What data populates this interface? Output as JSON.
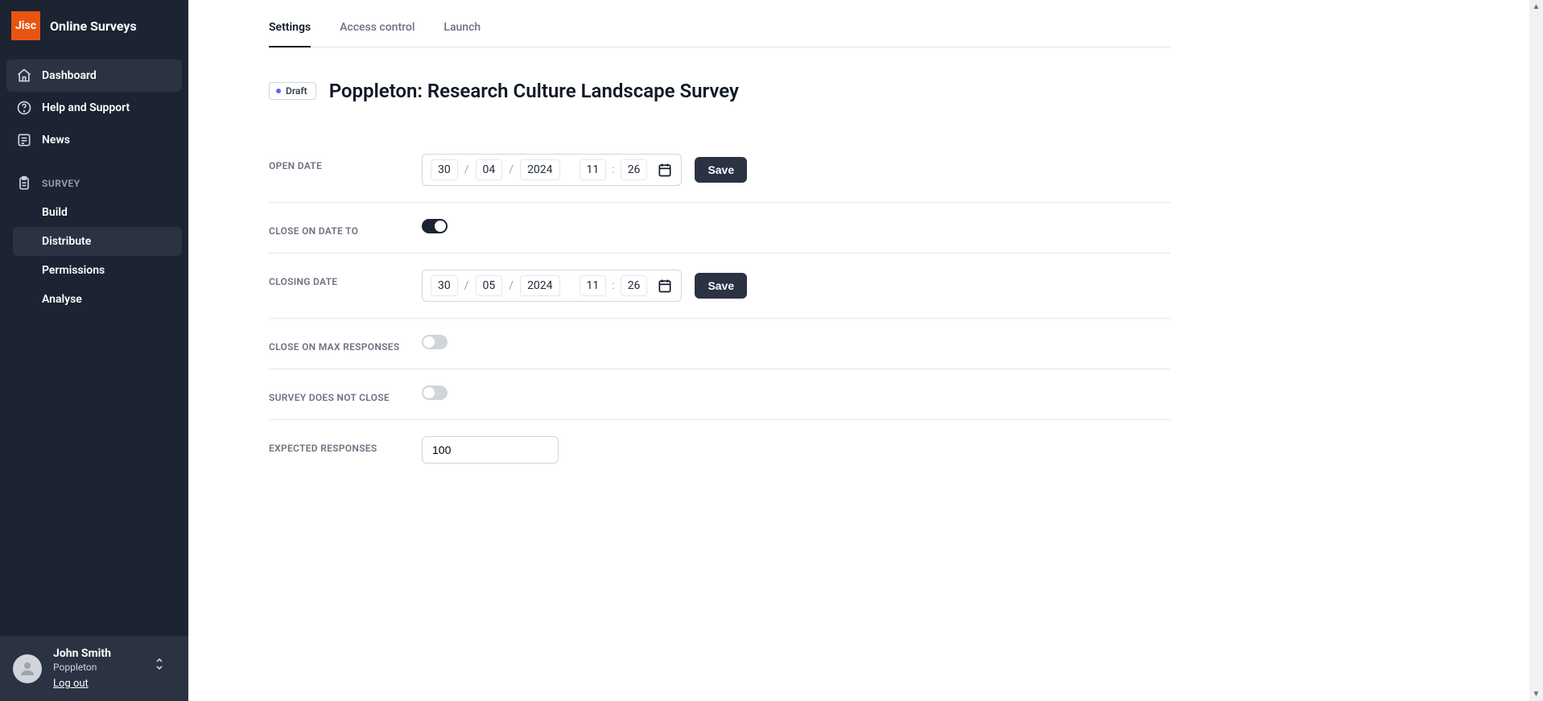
{
  "brand": {
    "logo_text": "Jisc",
    "title": "Online Surveys"
  },
  "nav": {
    "dashboard": "Dashboard",
    "help": "Help and Support",
    "news": "News",
    "survey_section": "SURVEY",
    "build": "Build",
    "distribute": "Distribute",
    "permissions": "Permissions",
    "analyse": "Analyse"
  },
  "user": {
    "name": "John Smith",
    "org": "Poppleton",
    "logout": "Log out"
  },
  "tabs": {
    "settings": "Settings",
    "access_control": "Access control",
    "launch": "Launch"
  },
  "status": {
    "label": "Draft"
  },
  "page_title": "Poppleton: Research Culture Landscape Survey",
  "labels": {
    "open_date": "OPEN DATE",
    "close_on_date_to": "CLOSE ON DATE TO",
    "closing_date": "CLOSING DATE",
    "close_on_max": "CLOSE ON MAX RESPONSES",
    "survey_no_close": "SURVEY DOES NOT CLOSE",
    "expected_responses": "EXPECTED RESPONSES"
  },
  "buttons": {
    "save": "Save"
  },
  "open_date": {
    "day": "30",
    "month": "04",
    "year": "2024",
    "hour": "11",
    "minute": "26"
  },
  "closing_date": {
    "day": "30",
    "month": "05",
    "year": "2024",
    "hour": "11",
    "minute": "26"
  },
  "expected_responses": "100",
  "separators": {
    "slash": "/",
    "colon": ":"
  }
}
